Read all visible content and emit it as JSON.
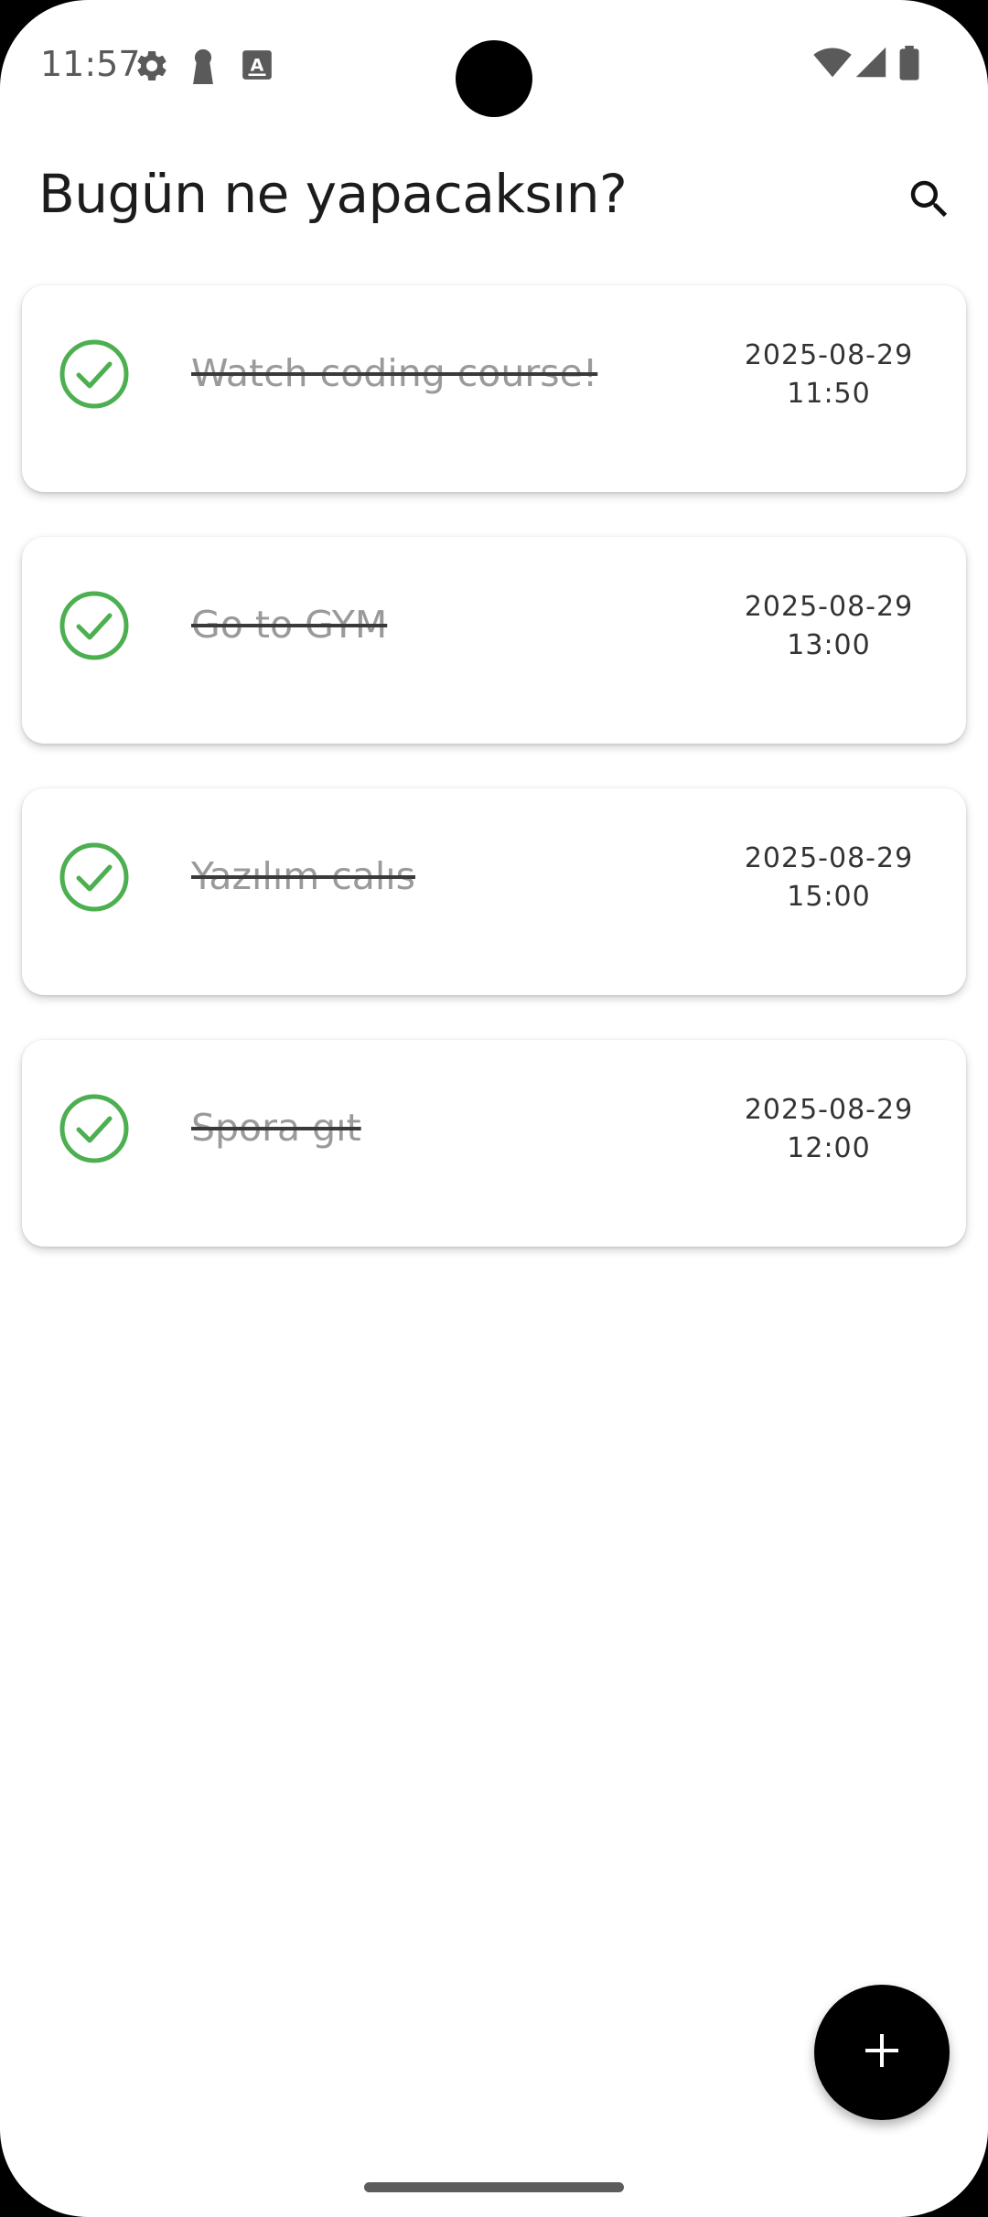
{
  "status_bar": {
    "time": "11:57",
    "left_icons": [
      "gear-icon",
      "keyhole-icon",
      "keyboard-a-icon"
    ],
    "right_icons": [
      "wifi-icon",
      "signal-icon",
      "battery-icon"
    ]
  },
  "app_bar": {
    "title": "Bugün ne yapacaksın?",
    "search_icon": "search-icon"
  },
  "tasks": [
    {
      "title": "Watch coding course!",
      "date": "2025-08-29",
      "time": "11:50",
      "completed": true
    },
    {
      "title": "Go to GYM",
      "date": "2025-08-29",
      "time": "13:00",
      "completed": true
    },
    {
      "title": "Yazılım calıs",
      "date": "2025-08-29",
      "time": "15:00",
      "completed": true
    },
    {
      "title": "Spora gıt",
      "date": "2025-08-29",
      "time": "12:00",
      "completed": true
    }
  ],
  "fab": {
    "icon": "plus-icon"
  },
  "colors": {
    "check_green": "#4caf50",
    "fab_background": "#000000",
    "background": "#ffffff"
  }
}
